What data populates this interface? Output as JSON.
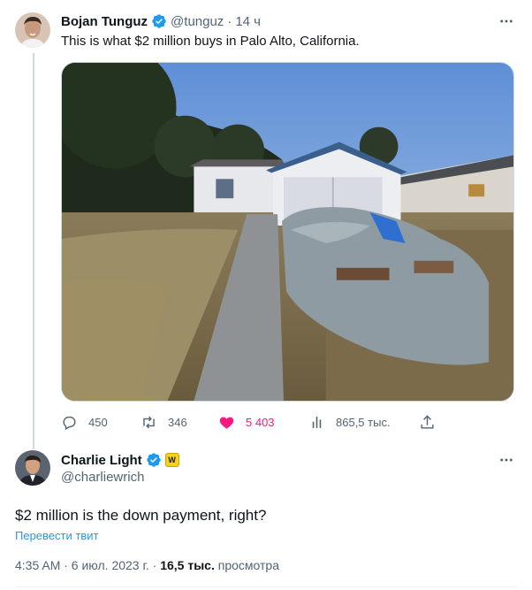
{
  "tweet": {
    "author_name": "Bojan Tunguz",
    "handle": "@tunguz",
    "separator": "·",
    "time": "14 ч",
    "text": "This is what $2 million buys in Palo Alto, California.",
    "actions": {
      "replies": "450",
      "retweets": "346",
      "likes": "5 403",
      "views": "865,5 тыс."
    },
    "photo_icon": "house-photo",
    "liked": true
  },
  "reply": {
    "author_name": "Charlie Light",
    "handle": "@charliewrich",
    "badge_label": "W",
    "text": "$2 million is the down payment, right?",
    "translate_label": "Перевести твит",
    "timestamp": "4:35 AM · 6 июл. 2023 г. · ",
    "views_count": "16,5 тыс.",
    "views_label": " просмотра"
  },
  "colors": {
    "verified": "#1d9bf0",
    "like": "#f91880",
    "secondary_text": "#536471",
    "link": "#1d9bf0"
  }
}
